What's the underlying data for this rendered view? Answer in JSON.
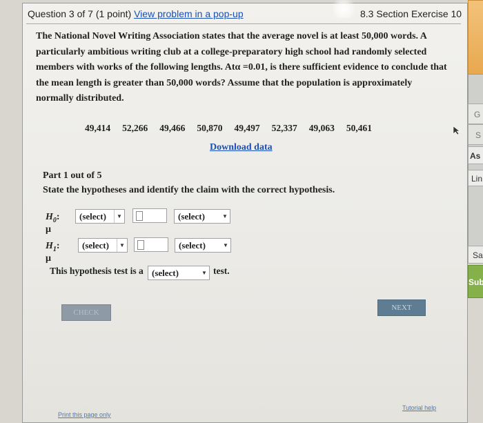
{
  "header": {
    "question_label": "Question 3 of 7 (1 point)",
    "popup_link": "View problem in a pop-up",
    "section": "8.3 Section Exercise 10"
  },
  "problem": {
    "text": "The National Novel Writing Association states that the average novel is at least 50,000 words. A particularly ambitious writing club at a college-preparatory high school had randomly selected members with works of the following lengths. Atα =0.01, is there sufficient evidence to conclude that the mean length is greater than 50,000 words? Assume that the population is approximately normally distributed."
  },
  "data_values": [
    "49,414",
    "52,266",
    "49,466",
    "50,870",
    "49,497",
    "52,337",
    "49,063",
    "50,461"
  ],
  "download_link": "Download data",
  "part": {
    "label": "Part 1 out of 5",
    "instruction": "State the hypotheses and identify the claim with the correct hypothesis."
  },
  "h0": {
    "label": "H",
    "sub": "0",
    "mu": ": μ",
    "operator_select": "(select)",
    "claim_select": "(select)"
  },
  "h1": {
    "label": "H",
    "sub": "1",
    "mu": ": μ",
    "operator_select": "(select)",
    "claim_select": "(select)"
  },
  "test_type": {
    "prefix": "This hypothesis test is a",
    "select": "(select)",
    "suffix": "test."
  },
  "buttons": {
    "check": "CHECK",
    "next": "NEXT"
  },
  "footer": {
    "print": "Print this page only",
    "tutorial": "Tutorial help"
  },
  "right_strip": {
    "items": [
      "G",
      "S",
      "As",
      "Lin",
      "Sa",
      "Subm"
    ]
  },
  "colors": {
    "link": "#1a4fb3",
    "next_button": "#5e7d93",
    "check_button": "#8e9aa5",
    "submit_green": "#86b04a"
  }
}
